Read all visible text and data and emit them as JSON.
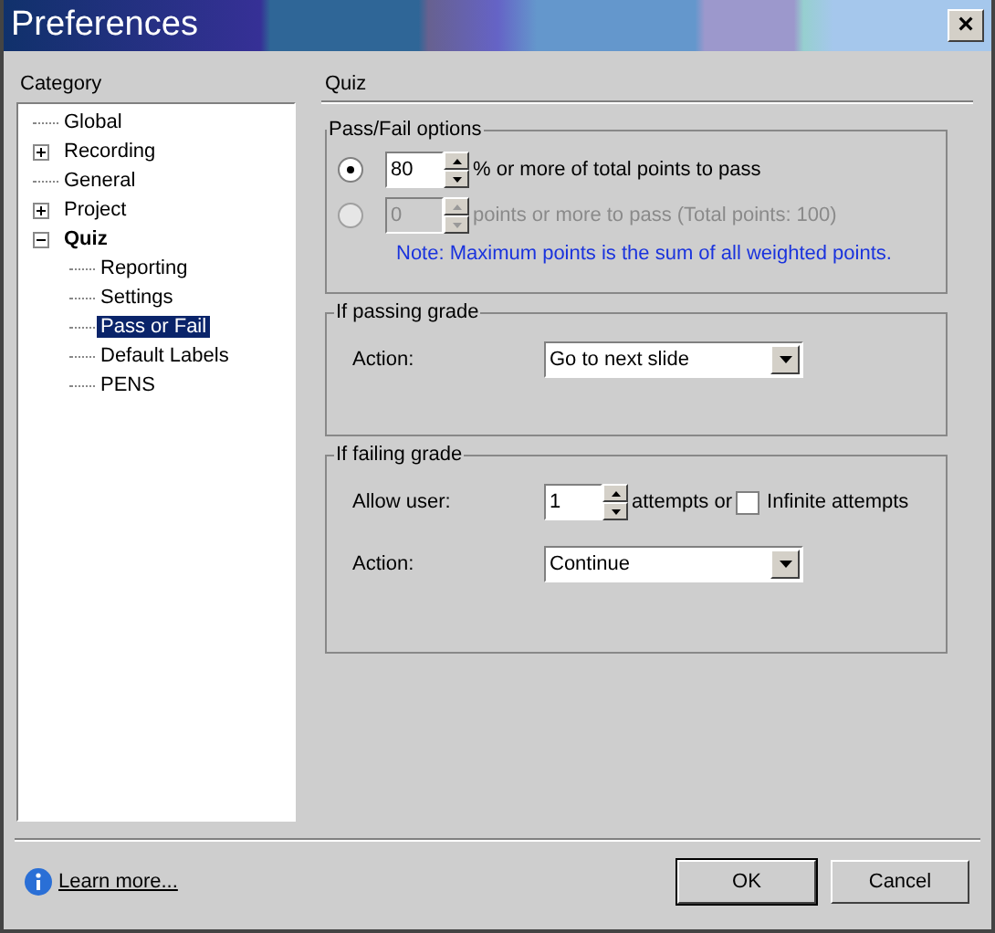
{
  "window": {
    "title": "Preferences",
    "close": "×"
  },
  "category": {
    "label": "Category",
    "items": [
      {
        "label": "Global",
        "selected": false
      },
      {
        "label": "Recording",
        "selected": false,
        "expanded": false
      },
      {
        "label": "General",
        "selected": false
      },
      {
        "label": "Project",
        "selected": false,
        "expanded": false
      },
      {
        "label": "Quiz",
        "selected": false,
        "expanded": true,
        "children": [
          {
            "label": "Reporting",
            "selected": false
          },
          {
            "label": "Settings",
            "selected": false
          },
          {
            "label": "Pass or Fail",
            "selected": true
          },
          {
            "label": "Default Labels",
            "selected": false
          },
          {
            "label": "PENS",
            "selected": false
          }
        ]
      }
    ]
  },
  "panel": {
    "title": "Quiz",
    "pass_fail": {
      "title": "Pass/Fail options",
      "options": [
        {
          "value": "80",
          "label": "% or more of total points to pass",
          "selected": true,
          "disabled": false
        },
        {
          "value": "0",
          "label": "points or more to pass (Total points: 100)",
          "selected": false,
          "disabled": true
        }
      ],
      "note": "Note: Maximum points is the sum of all weighted points."
    },
    "passing": {
      "title": "If passing grade",
      "action_label": "Action:",
      "action": "Go to next slide"
    },
    "failing": {
      "title": "If failing grade",
      "allow_label": "Allow user:",
      "attempts": "1",
      "attempts_suffix": "attempts or",
      "infinite": {
        "label": "Infinite attempts",
        "checked": false
      },
      "action_label": "Action:",
      "action": "Continue"
    }
  },
  "footer": {
    "link": "Learn more...",
    "buttons": [
      {
        "label": "OK",
        "default": true
      },
      {
        "label": "Cancel",
        "default": false
      }
    ]
  }
}
